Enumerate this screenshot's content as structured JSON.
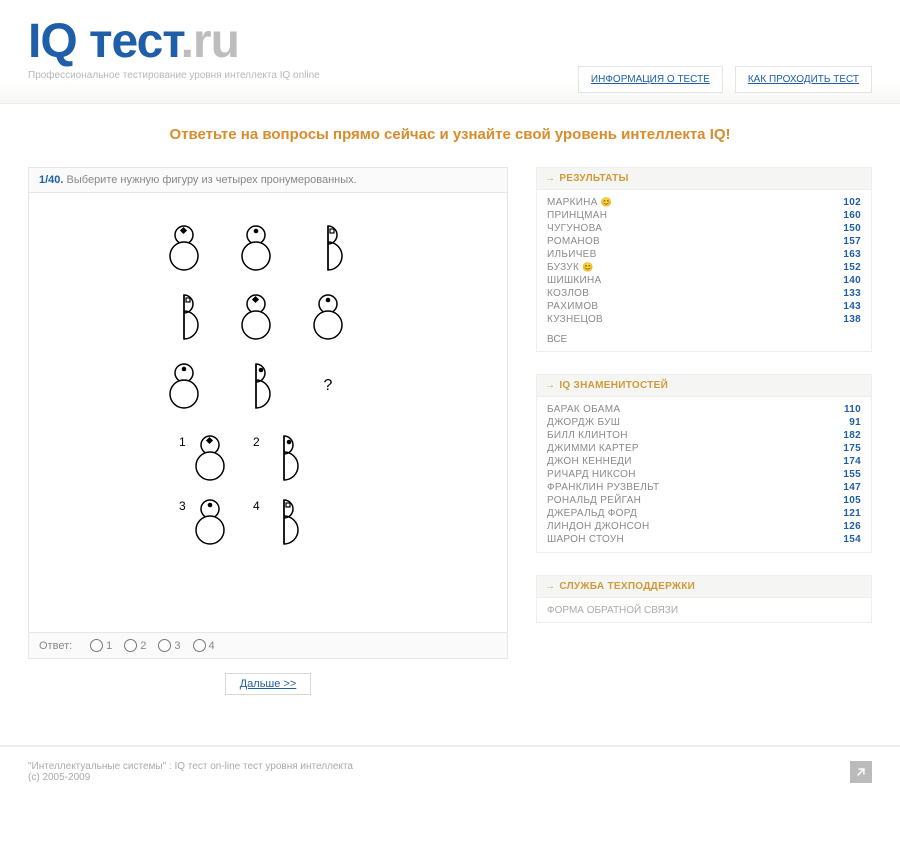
{
  "header": {
    "logo_main": "IQ тест",
    "logo_suffix": ".ru",
    "tagline": "Профессиональное тестирование уровня интеллекта IQ online",
    "links": {
      "info": "ИНФОРМАЦИЯ О ТЕСТЕ",
      "howto": "КАК ПРОХОДИТЬ ТЕСТ"
    }
  },
  "headline": "Ответьте на вопросы прямо сейчас и узнайте свой уровень интеллекта IQ!",
  "question": {
    "num": "1/40.",
    "text": "Выберите нужную фигуру из четырех пронумерованных.",
    "qmark": "?",
    "answer_label": "Ответ:",
    "options": {
      "o1": "1",
      "o2": "2",
      "o3": "3",
      "o4": "4"
    },
    "ans_nums": {
      "a1": "1",
      "a2": "2",
      "a3": "3",
      "a4": "4"
    },
    "next": "Дальше >>"
  },
  "sidebar": {
    "results": {
      "title": "РЕЗУЛЬТАТЫ",
      "rows": [
        {
          "name": "МАРКИНА",
          "score": "102",
          "smile": true
        },
        {
          "name": "ПРИНЦМАН",
          "score": "160",
          "smile": false
        },
        {
          "name": "ЧУГУНОВА",
          "score": "150",
          "smile": false
        },
        {
          "name": "РОМАНОВ",
          "score": "157",
          "smile": false
        },
        {
          "name": "ИЛЬИЧЕВ",
          "score": "163",
          "smile": false
        },
        {
          "name": "БУЗУК",
          "score": "152",
          "smile": true
        },
        {
          "name": "ШИШКИНА",
          "score": "140",
          "smile": false
        },
        {
          "name": "КОЗЛОВ",
          "score": "133",
          "smile": false
        },
        {
          "name": "РАХИМОВ",
          "score": "143",
          "smile": false
        },
        {
          "name": "КУЗНЕЦОВ",
          "score": "138",
          "smile": false
        }
      ],
      "all": "ВСЕ"
    },
    "celebs": {
      "title": "IQ ЗНАМЕНИТОСТЕЙ",
      "rows": [
        {
          "name": "БАРАК ОБАМА",
          "score": "110"
        },
        {
          "name": "ДЖОРДЖ БУШ",
          "score": "91"
        },
        {
          "name": "БИЛЛ КЛИНТОН",
          "score": "182"
        },
        {
          "name": "ДЖИММИ КАРТЕР",
          "score": "175"
        },
        {
          "name": "ДЖОН КЕННЕДИ",
          "score": "174"
        },
        {
          "name": "РИЧАРД НИКСОН",
          "score": "155"
        },
        {
          "name": "ФРАНКЛИН РУЗВЕЛЬТ",
          "score": "147"
        },
        {
          "name": "РОНАЛЬД РЕЙГАН",
          "score": "105"
        },
        {
          "name": "ДЖЕРАЛЬД ФОРД",
          "score": "121"
        },
        {
          "name": "ЛИНДОН ДЖОНСОН",
          "score": "126"
        },
        {
          "name": "ШАРОН СТОУН",
          "score": "154"
        }
      ]
    },
    "support": {
      "title": "СЛУЖБА ТЕХПОДДЕРЖКИ",
      "link": "ФОРМА ОБРАТНОЙ СВЯЗИ"
    }
  },
  "footer": {
    "line1": "\"Интеллектуальные системы\" : IQ тест on-line тест уровня интеллекта",
    "line2": "(с) 2005-2009"
  }
}
